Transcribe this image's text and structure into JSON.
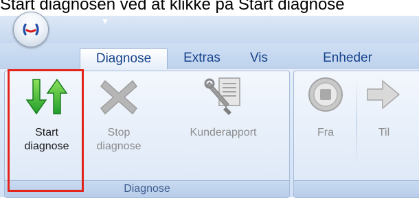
{
  "instruction": "Start diagnosen ved at klikke på Start diagnose",
  "ribbon": {
    "tabs": [
      {
        "label": "Diagnose",
        "active": true
      },
      {
        "label": "Extras",
        "active": false
      },
      {
        "label": "Vis",
        "active": false
      },
      {
        "label": "Enheder",
        "active": false
      }
    ],
    "groups": [
      {
        "label": "Diagnose",
        "buttons": [
          {
            "line1": "Start",
            "line2": "diagnose",
            "icon": "start-diagnose-arrows-icon",
            "enabled": true,
            "highlighted": true
          },
          {
            "line1": "Stop",
            "line2": "diagnose",
            "icon": "stop-x-icon",
            "enabled": false
          },
          {
            "line1": "Kunderapport",
            "line2": "",
            "icon": "customer-report-icon",
            "enabled": false
          }
        ]
      },
      {
        "label": "",
        "buttons": [
          {
            "line1": "Fra",
            "line2": "",
            "icon": "stop-circle-icon",
            "enabled": false
          },
          {
            "line1": "Til",
            "line2": "",
            "icon": "arrow-right-icon",
            "enabled": false
          }
        ]
      }
    ]
  },
  "colors": {
    "highlight": "#e2231a",
    "start_icon_green": "#2fb52f",
    "tab_text": "#15428b",
    "disabled_text": "#8d8d8d"
  }
}
